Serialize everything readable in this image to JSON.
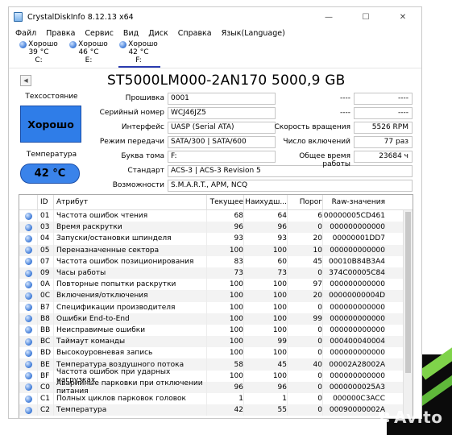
{
  "window": {
    "title": "CrystalDiskInfo 8.12.13 x64",
    "controls": {
      "minimize": "—",
      "maximize": "☐",
      "close": "✕"
    }
  },
  "menu": [
    "Файл",
    "Правка",
    "Сервис",
    "Вид",
    "Диск",
    "Справка",
    "Язык(Language)"
  ],
  "drives": [
    {
      "status": "Хорошо",
      "temp": "39 °C",
      "letter": "C:"
    },
    {
      "status": "Хорошо",
      "temp": "46 °C",
      "letter": "E:"
    },
    {
      "status": "Хорошо",
      "temp": "42 °C",
      "letter": "F:",
      "active": true
    }
  ],
  "model": "ST5000LM000-2AN170 5000,9 GB",
  "status": {
    "label": "Техсостояние",
    "value": "Хорошо",
    "temp_label": "Температура",
    "temp_value": "42 °C",
    "color": "#2f7de8"
  },
  "fields": {
    "firmware": {
      "label": "Прошивка",
      "value": "0001"
    },
    "serial": {
      "label": "Серийный номер",
      "value": "WCJ46JZ5"
    },
    "interface": {
      "label": "Интерфейс",
      "value": "UASP (Serial ATA)"
    },
    "transfer": {
      "label": "Режим передачи",
      "value": "SATA/300 | SATA/600"
    },
    "volume": {
      "label": "Буква тома",
      "value": "F:"
    },
    "standard": {
      "label": "Стандарт",
      "value": "ACS-3 | ACS-3 Revision 5"
    },
    "features": {
      "label": "Возможности",
      "value": "S.M.A.R.T., APM, NCQ"
    },
    "blank1": {
      "label": "----",
      "value": "----"
    },
    "blank2": {
      "label": "----",
      "value": "----"
    },
    "rotation": {
      "label": "Скорость вращения",
      "value": "5526 RPM"
    },
    "power_count": {
      "label": "Число включений",
      "value": "77 раз"
    },
    "power_hours": {
      "label": "Общее время работы",
      "value": "23684 ч"
    }
  },
  "smart": {
    "headers": {
      "id": "ID",
      "attr": "Атрибут",
      "current": "Текущее",
      "worst": "Наихудш...",
      "threshold": "Порог",
      "raw": "Raw-значения"
    },
    "rows": [
      {
        "id": "01",
        "attr": "Частота ошибок чтения",
        "cur": "68",
        "worst": "64",
        "thr": "6",
        "raw": "00000005CD461"
      },
      {
        "id": "03",
        "attr": "Время раскрутки",
        "cur": "96",
        "worst": "96",
        "thr": "0",
        "raw": "000000000000"
      },
      {
        "id": "04",
        "attr": "Запуски/остановки шпинделя",
        "cur": "93",
        "worst": "93",
        "thr": "20",
        "raw": "00000001DD7"
      },
      {
        "id": "05",
        "attr": "Переназначенные сектора",
        "cur": "100",
        "worst": "100",
        "thr": "10",
        "raw": "000000000000"
      },
      {
        "id": "07",
        "attr": "Частота ошибок позиционирования",
        "cur": "83",
        "worst": "60",
        "thr": "45",
        "raw": "00010B84B3A4"
      },
      {
        "id": "09",
        "attr": "Часы работы",
        "cur": "73",
        "worst": "73",
        "thr": "0",
        "raw": "374C00005C84"
      },
      {
        "id": "0A",
        "attr": "Повторные попытки раскрутки",
        "cur": "100",
        "worst": "100",
        "thr": "97",
        "raw": "000000000000"
      },
      {
        "id": "0C",
        "attr": "Включения/отключения",
        "cur": "100",
        "worst": "100",
        "thr": "20",
        "raw": "00000000004D"
      },
      {
        "id": "B7",
        "attr": "Спецификации производителя",
        "cur": "100",
        "worst": "100",
        "thr": "0",
        "raw": "000000000000"
      },
      {
        "id": "B8",
        "attr": "Ошибки End-to-End",
        "cur": "100",
        "worst": "100",
        "thr": "99",
        "raw": "000000000000"
      },
      {
        "id": "BB",
        "attr": "Неисправимые ошибки",
        "cur": "100",
        "worst": "100",
        "thr": "0",
        "raw": "000000000000"
      },
      {
        "id": "BC",
        "attr": "Таймаут команды",
        "cur": "100",
        "worst": "99",
        "thr": "0",
        "raw": "000400040004"
      },
      {
        "id": "BD",
        "attr": "Высокоуровневая запись",
        "cur": "100",
        "worst": "100",
        "thr": "0",
        "raw": "000000000000"
      },
      {
        "id": "BE",
        "attr": "Температура воздушного потока",
        "cur": "58",
        "worst": "45",
        "thr": "40",
        "raw": "00002A28002A"
      },
      {
        "id": "BF",
        "attr": "Частота ошибок при ударных нагрузках",
        "cur": "100",
        "worst": "100",
        "thr": "0",
        "raw": "000000000000"
      },
      {
        "id": "C0",
        "attr": "Аварийные парковки при отключении питания",
        "cur": "96",
        "worst": "96",
        "thr": "0",
        "raw": "0000000025A3"
      },
      {
        "id": "C1",
        "attr": "Полных циклов парковок головок",
        "cur": "1",
        "worst": "1",
        "thr": "0",
        "raw": "000000C3ACC"
      },
      {
        "id": "C2",
        "attr": "Температура",
        "cur": "42",
        "worst": "55",
        "thr": "0",
        "raw": "00090000002A"
      }
    ]
  },
  "watermark": "Avito"
}
